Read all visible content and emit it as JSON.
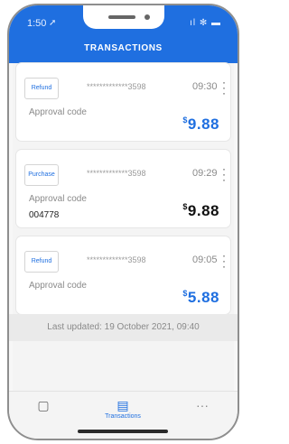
{
  "status": {
    "time": "1:50",
    "nav_glyph": "➚",
    "right_glyphs": "ıl ✻ ▬"
  },
  "header": {
    "title": "TRANSACTIONS",
    "color": "#1f6fe0"
  },
  "transactions": [
    {
      "type": "Refund",
      "card_number": "*************3598",
      "time": "09:30",
      "approval_label": "Approval code",
      "approval_code": "",
      "currency": "$",
      "amount": "9.88",
      "amount_color": "blue"
    },
    {
      "type": "Purchase",
      "card_number": "*************3598",
      "time": "09:29",
      "approval_label": "Approval code",
      "approval_code": "004778",
      "currency": "$",
      "amount": "9.88",
      "amount_color": "dark"
    },
    {
      "type": "Refund",
      "card_number": "*************3598",
      "time": "09:05",
      "approval_label": "Approval code",
      "approval_code": "",
      "currency": "$",
      "amount": "5.88",
      "amount_color": "blue"
    }
  ],
  "last_updated": "Last updated: 19 October 2021, 09:40",
  "bottom_nav": {
    "items": [
      {
        "icon": "wallet-icon",
        "glyph": "▢",
        "label": ""
      },
      {
        "icon": "transactions-icon",
        "glyph": "▤",
        "label": "Transactions"
      },
      {
        "icon": "more-icon",
        "glyph": "···",
        "label": ""
      }
    ]
  }
}
